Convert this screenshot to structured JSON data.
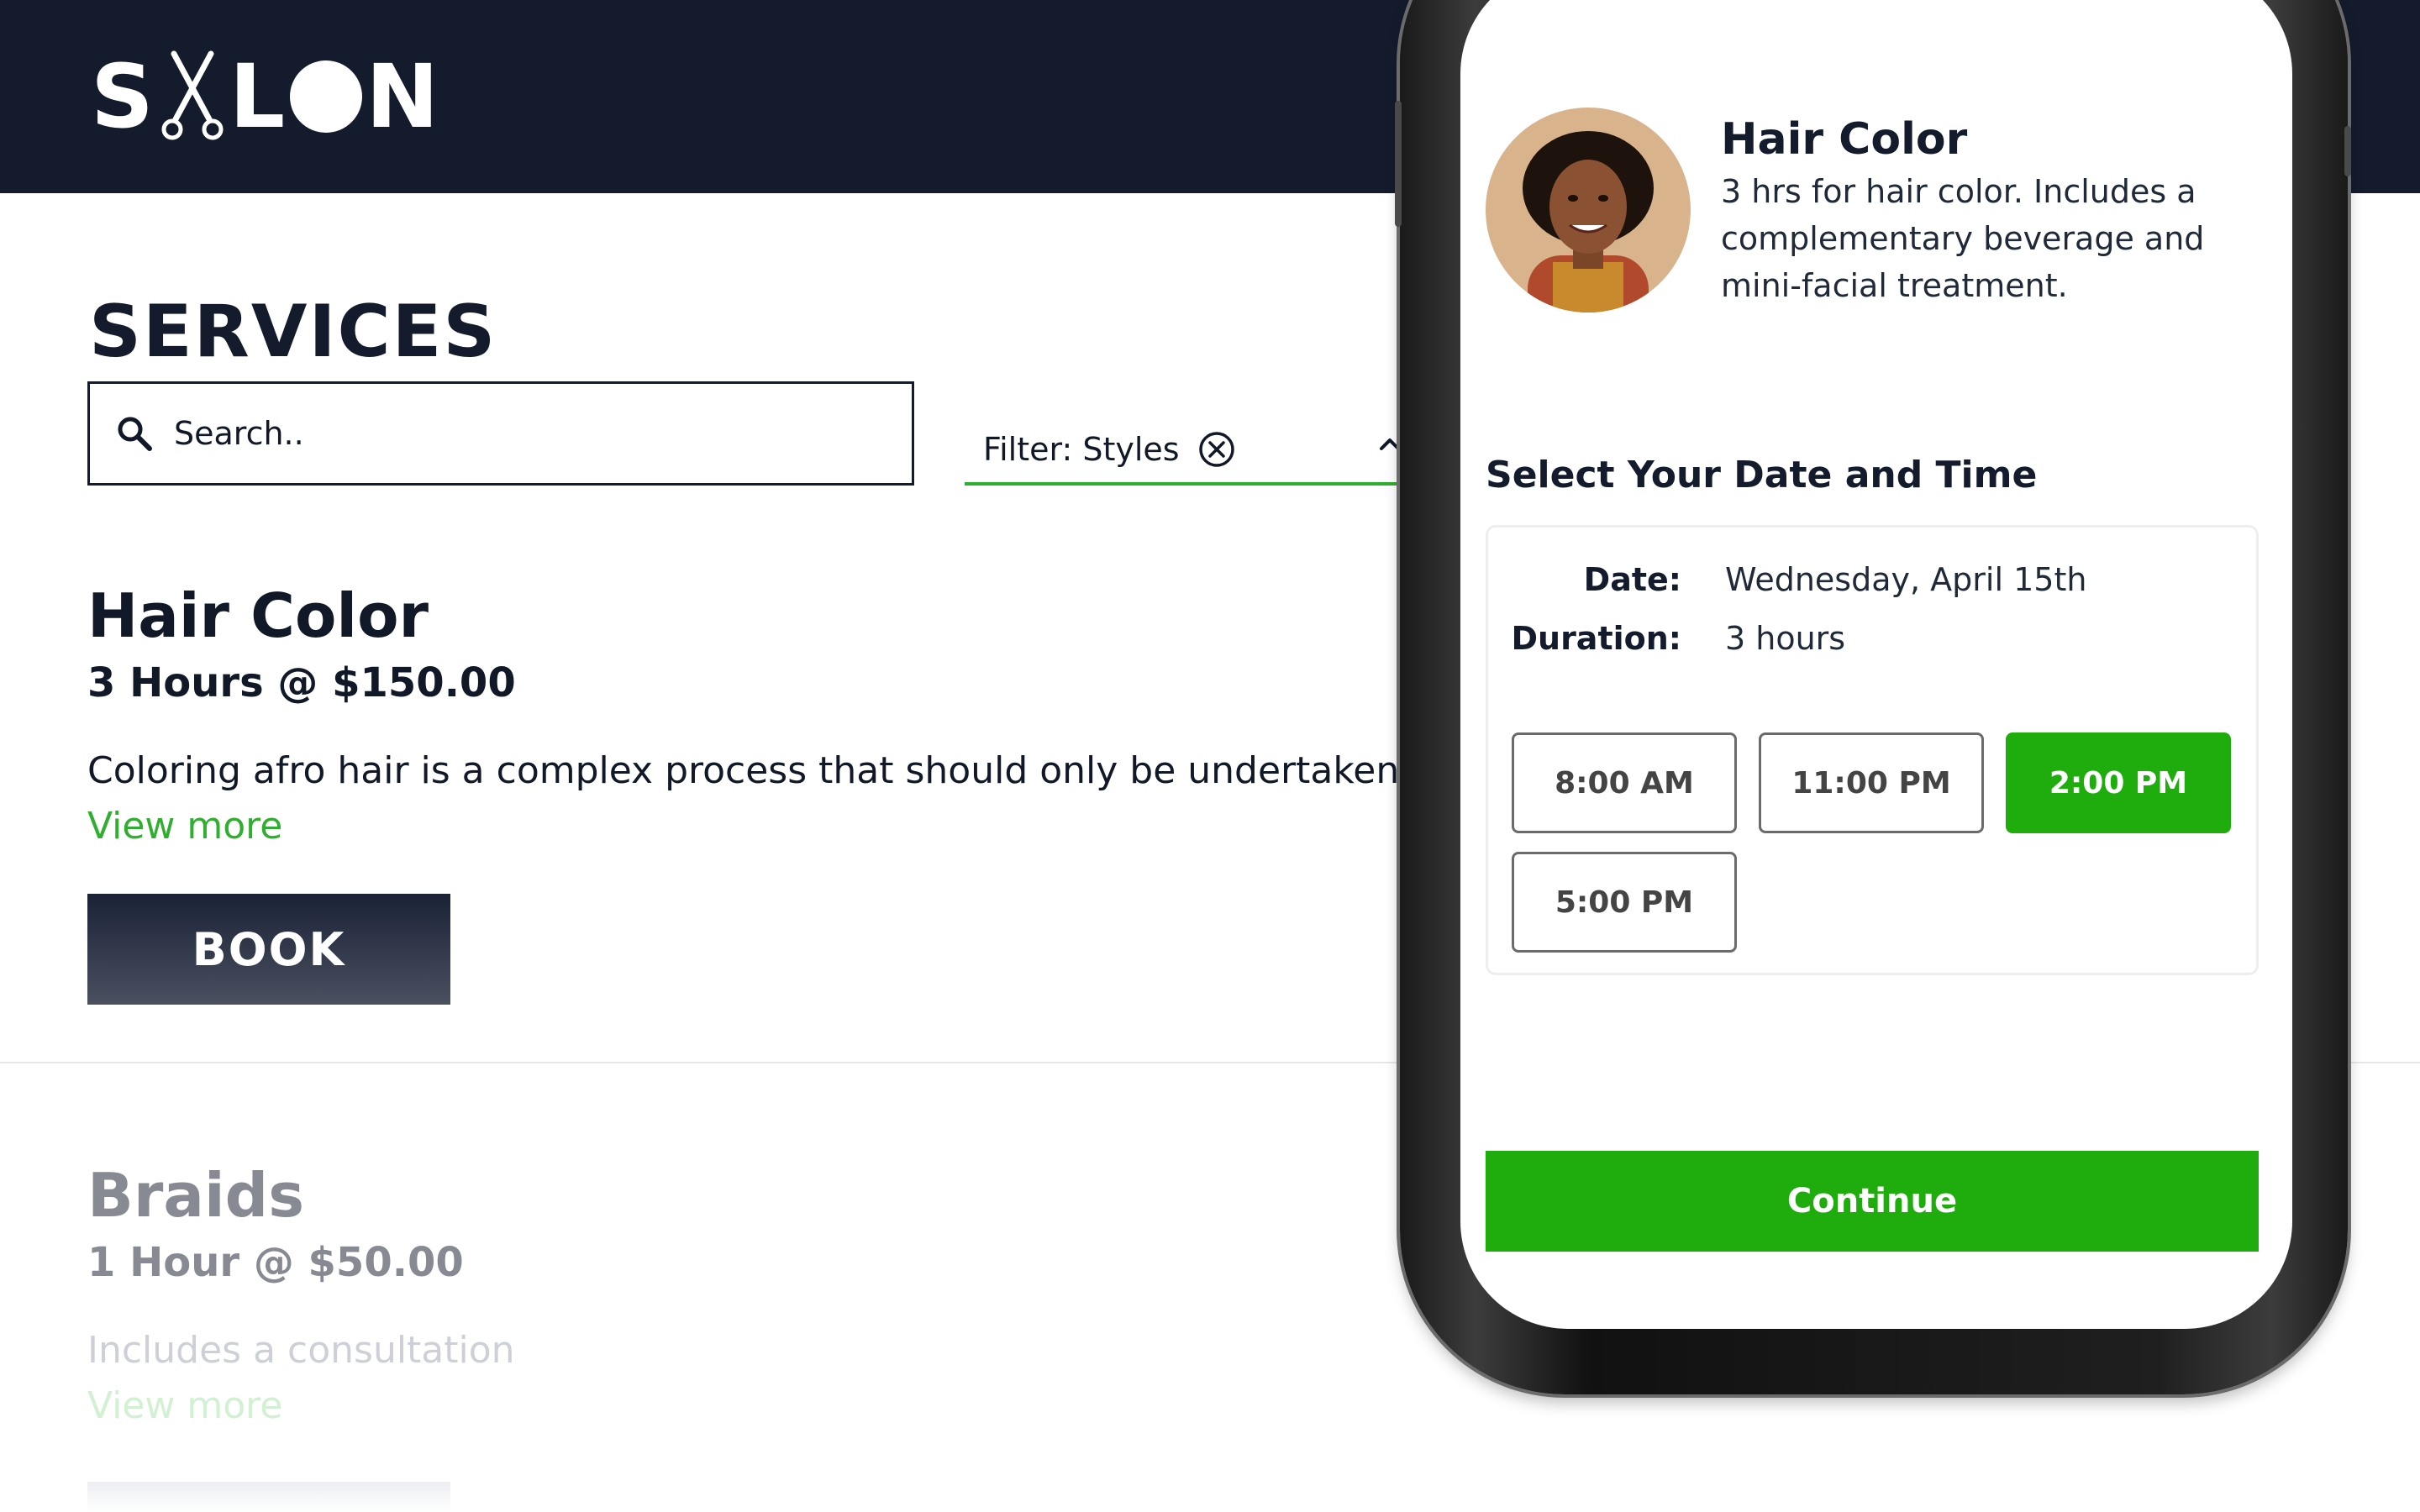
{
  "brand": {
    "logo_start": "S",
    "logo_end": "L",
    "logo_tail": "N"
  },
  "page": {
    "title": "SERVICES"
  },
  "search": {
    "placeholder": "Search.."
  },
  "filter": {
    "label": "Filter: Styles"
  },
  "services": [
    {
      "name": "Hair Color",
      "meta": "3 Hours @ $150.00",
      "description": "Coloring afro hair is a complex process that should only be undertaken by..",
      "more": "View more",
      "cta": "BOOK"
    },
    {
      "name": "Braids",
      "meta": "1 Hour @ $50.00",
      "description": "Includes a consultation",
      "more": "View more"
    }
  ],
  "booking": {
    "service_title": "Hair Color",
    "service_desc": "3 hrs for hair color. Includes a complementary beverage and mini-facial treatment.",
    "heading": "Select Your Date and Time",
    "date_label": "Date:",
    "date_value": "Wednesday, April 15th",
    "duration_label": "Duration:",
    "duration_value": "3 hours",
    "slots": [
      "8:00 AM",
      "11:00 PM",
      "2:00 PM",
      "5:00 PM"
    ],
    "selected_slot": "2:00 PM",
    "continue_label": "Continue"
  },
  "colors": {
    "navy": "#131b2d",
    "accent_green": "#1fad0e",
    "underline_green": "#2fae2f"
  }
}
